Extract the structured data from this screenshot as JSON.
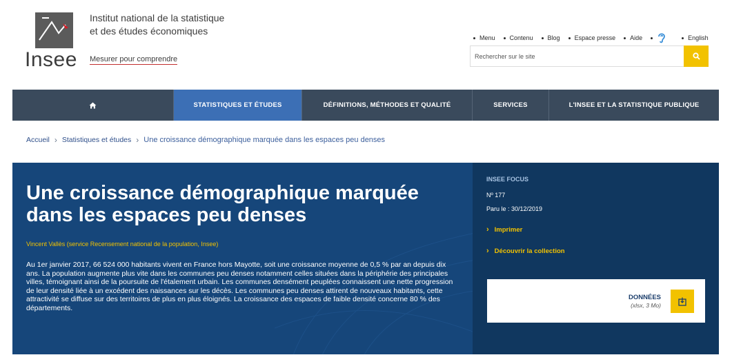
{
  "header": {
    "logo_text": "Insee",
    "org_name_line1": "Institut national de la statistique",
    "org_name_line2": "et des études économiques",
    "tagline": "Mesurer pour comprendre",
    "top_links": [
      "Menu",
      "Contenu",
      "Blog",
      "Espace presse",
      "Aide"
    ],
    "english_label": "English",
    "search_placeholder": "Rechercher sur le site"
  },
  "nav": {
    "home_icon": "home-icon",
    "items": [
      "STATISTIQUES ET ÉTUDES",
      "DÉFINITIONS, MÉTHODES ET QUALITÉ",
      "SERVICES",
      "L'INSEE ET LA STATISTIQUE PUBLIQUE"
    ],
    "active": "STATISTIQUES ET ÉTUDES"
  },
  "breadcrumb": {
    "items": [
      "Accueil",
      "Statistiques et études"
    ],
    "current": "Une croissance démographique marquée dans les espaces peu denses"
  },
  "article": {
    "title": "Une croissance démographique marquée dans les espaces peu denses",
    "author": "Vincent Vallès (service Recensement national de la population, Insee)",
    "abstract": "Au 1er janvier 2017, 66 524 000 habitants vivent en France hors Mayotte, soit une croissance moyenne de 0,5 % par an depuis dix ans. La population augmente plus vite dans les communes peu denses notamment celles situées dans la périphérie des principales villes, témoignant ainsi de la poursuite de l'étalement urbain. Les communes densément peuplées connaissent une nette progression de leur densité liée à un excédent des naissances sur les décès. Les communes peu denses attirent de nouveaux habitants, cette attractivité se diffuse sur des territoires de plus en plus éloignés. La croissance des espaces de faible densité concerne 80 % des départements."
  },
  "sidebar": {
    "collection": "INSEE FOCUS",
    "number": "Nº 177",
    "date": "Paru le : 30/12/2019",
    "print_label": "Imprimer",
    "collection_link": "Découvrir la collection",
    "data_title": "DONNÉES",
    "data_sub": "(xlsx, 3 Mo)"
  },
  "colors": {
    "nav_bg": "#3a4a5c",
    "nav_active": "#3c6fb5",
    "banner": "#16467a",
    "accent_yellow": "#f2c200"
  }
}
